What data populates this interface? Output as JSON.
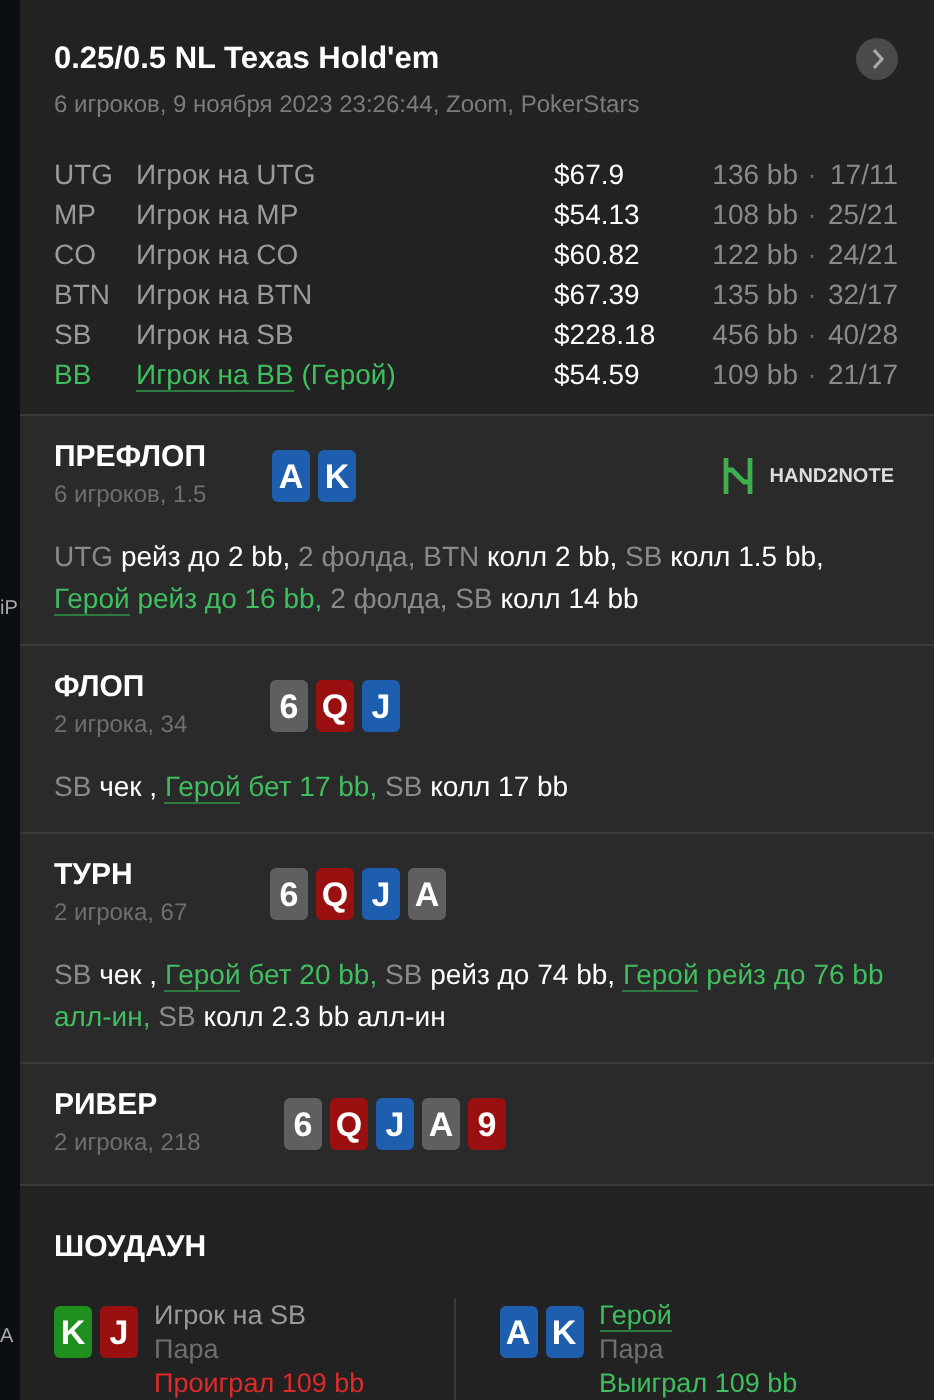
{
  "edge_fragments": [
    "iP",
    "A"
  ],
  "header": {
    "title": "0.25/0.5 NL Texas Hold'em",
    "subtitle": "6 игроков, 9 ноября 2023 23:26:44, Zoom, PokerStars",
    "players": [
      {
        "position": "UTG",
        "name": "Игрок на UTG",
        "hero": false,
        "stack": "$67.9",
        "sep": "·",
        "bb": "136 bb",
        "stats": "17/11"
      },
      {
        "position": "MP",
        "name": "Игрок на MP",
        "hero": false,
        "stack": "$54.13",
        "sep": "·",
        "bb": "108 bb",
        "stats": "25/21"
      },
      {
        "position": "CO",
        "name": "Игрок на CO",
        "hero": false,
        "stack": "$60.82",
        "sep": "·",
        "bb": "122 bb",
        "stats": "24/21"
      },
      {
        "position": "BTN",
        "name": "Игрок на BTN",
        "hero": false,
        "stack": "$67.39",
        "sep": "·",
        "bb": "135 bb",
        "stats": "32/17"
      },
      {
        "position": "SB",
        "name": "Игрок на SB",
        "hero": false,
        "stack": "$228.18",
        "sep": "·",
        "bb": "456 bb",
        "stats": "40/28"
      },
      {
        "position": "BB",
        "name": "Игрок на BB",
        "hero": true,
        "hero_tag": "(Герой)",
        "stack": "$54.59",
        "sep": "·",
        "bb": "109 bb",
        "stats": "21/17"
      }
    ]
  },
  "streets": [
    {
      "title": "ПРЕФЛОП",
      "info": "6 игроков, 1.5",
      "logo": "HAND2NOTE",
      "cards": [
        {
          "rank": "A",
          "color": "#1d5fae"
        },
        {
          "rank": "K",
          "color": "#1d5fae"
        }
      ],
      "actions": [
        {
          "actor": "UTG",
          "hero": false,
          "action": "рейз до 2 bb,"
        },
        {
          "actor": "2 фолда,",
          "hero": false
        },
        {
          "actor": "BTN",
          "hero": false,
          "action": "колл 2 bb,"
        },
        {
          "actor": "SB",
          "hero": false,
          "action": "колл 1.5 bb,"
        },
        {
          "actor": "Герой",
          "hero": true,
          "action": "рейз до 16 bb,"
        },
        {
          "actor": "2 фолда,",
          "hero": false
        },
        {
          "actor": "SB",
          "hero": false,
          "action": "колл 14 bb"
        }
      ]
    },
    {
      "title": "ФЛОП",
      "info": "2 игрока, 34",
      "cards": [
        {
          "rank": "6",
          "color": "#5f5f5f"
        },
        {
          "rank": "Q",
          "color": "#9a0f0f"
        },
        {
          "rank": "J",
          "color": "#1d5fae"
        }
      ],
      "actions": [
        {
          "actor": "SB",
          "hero": false,
          "action": "чек ,"
        },
        {
          "actor": "Герой",
          "hero": true,
          "action": "бет 17 bb,"
        },
        {
          "actor": "SB",
          "hero": false,
          "action": "колл 17 bb"
        }
      ]
    },
    {
      "title": "ТУРН",
      "info": "2 игрока, 67",
      "cards": [
        {
          "rank": "6",
          "color": "#5f5f5f"
        },
        {
          "rank": "Q",
          "color": "#9a0f0f"
        },
        {
          "rank": "J",
          "color": "#1d5fae"
        },
        {
          "rank": "A",
          "color": "#5f5f5f"
        }
      ],
      "actions": [
        {
          "actor": "SB",
          "hero": false,
          "action": "чек ,"
        },
        {
          "actor": "Герой",
          "hero": true,
          "action": "бет 20 bb,"
        },
        {
          "actor": "SB",
          "hero": false,
          "action": "рейз до 74 bb,"
        },
        {
          "actor": "Герой",
          "hero": true,
          "action_lines": [
            "рейз до 76 bb",
            "алл-ин,"
          ]
        },
        {
          "actor": "SB",
          "hero": false,
          "action": "колл 2.3 bb алл-ин"
        }
      ]
    },
    {
      "title": "РИВЕР",
      "info": "2 игрока, 218",
      "cards": [
        {
          "rank": "6",
          "color": "#5f5f5f"
        },
        {
          "rank": "Q",
          "color": "#9a0f0f"
        },
        {
          "rank": "J",
          "color": "#1d5fae"
        },
        {
          "rank": "A",
          "color": "#5f5f5f"
        },
        {
          "rank": "9",
          "color": "#9a0f0f"
        }
      ]
    }
  ],
  "showdown": {
    "title": "ШОУДАУН",
    "hands": [
      {
        "name": "Игрок на SB",
        "hero": false,
        "combo": "Пара",
        "result": "Проиграл 109 bb",
        "won": false,
        "cards": [
          {
            "rank": "K",
            "color": "#1f8f1f"
          },
          {
            "rank": "J",
            "color": "#9a0f0f"
          }
        ]
      },
      {
        "name": "Герой",
        "hero": true,
        "combo": "Пара",
        "result": "Выиграл 109 bb",
        "won": true,
        "cards": [
          {
            "rank": "A",
            "color": "#1d5fae"
          },
          {
            "rank": "K",
            "color": "#1d5fae"
          }
        ]
      }
    ]
  }
}
